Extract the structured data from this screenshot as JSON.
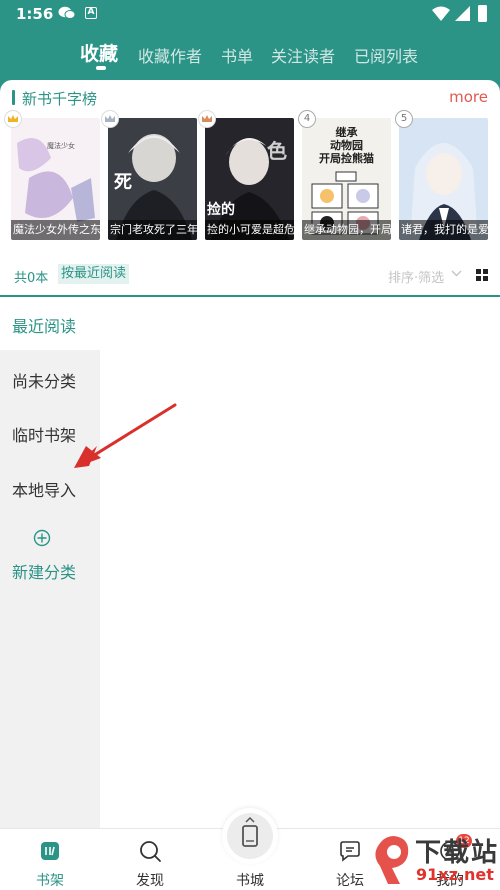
{
  "status_bar": {
    "time": "1:56"
  },
  "top_tabs": [
    {
      "label": "收藏",
      "active": true
    },
    {
      "label": "收藏作者",
      "active": false
    },
    {
      "label": "书单",
      "active": false
    },
    {
      "label": "关注读者",
      "active": false
    },
    {
      "label": "已阅列表",
      "active": false
    }
  ],
  "ranking": {
    "title": "新书千字榜",
    "more": "more",
    "books": [
      {
        "rank": "1",
        "caption": "魔法少女外传之东",
        "cover_color": "#f4eef2"
      },
      {
        "rank": "2",
        "caption": "宗门老攻死了三年",
        "cover_color": "#3b3e45"
      },
      {
        "rank": "3",
        "caption": "捡的小可爱是超危",
        "cover_color": "#26252b"
      },
      {
        "rank": "4",
        "caption": "继承动物园，开局",
        "cover_color": "#f2f1ec",
        "cover_text": [
          "继承",
          "动物园",
          "开局捡熊猫"
        ]
      },
      {
        "rank": "5",
        "caption": "诸君，我打的是爱",
        "cover_color": "#d6e4f3"
      }
    ],
    "crown_colors": [
      "#f0b429",
      "#a9b4c2",
      "#d98b5b"
    ]
  },
  "shelf": {
    "count": "共0本",
    "sort_label": "按最近阅读",
    "filter_label": "排序·筛选"
  },
  "categories": {
    "recent": "最近阅读",
    "items": [
      "尚未分类",
      "临时书架",
      "本地导入"
    ],
    "new_label": "新建分类"
  },
  "bottom_nav": {
    "items": [
      {
        "label": "书架",
        "active": true
      },
      {
        "label": "发现",
        "active": false
      },
      {
        "label": "书城",
        "active": false
      },
      {
        "label": "论坛",
        "active": false
      },
      {
        "label": "我的",
        "active": false
      }
    ],
    "badge": "12"
  },
  "watermark": {
    "big": "下载站",
    "small": "91xz.net"
  },
  "colors": {
    "accent": "#2b9487",
    "more": "#e05a50",
    "arrow": "#d9302b"
  }
}
